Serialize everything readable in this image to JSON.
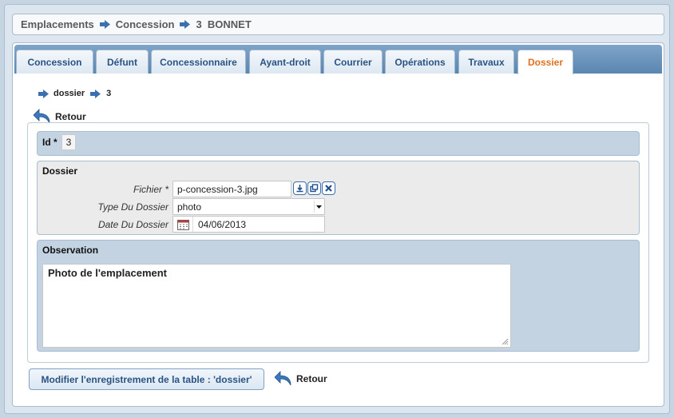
{
  "breadcrumb": {
    "items": [
      "Emplacements",
      "Concession",
      "3  BONNET"
    ]
  },
  "tabs": [
    {
      "label": "Concession"
    },
    {
      "label": "Défunt"
    },
    {
      "label": "Concessionnaire"
    },
    {
      "label": "Ayant-droit"
    },
    {
      "label": "Courrier"
    },
    {
      "label": "Opérations"
    },
    {
      "label": "Travaux"
    },
    {
      "label": "Dossier"
    }
  ],
  "active_tab": "Dossier",
  "sub_breadcrumb": {
    "items": [
      "dossier",
      "3"
    ]
  },
  "retour_label": "Retour",
  "id_section": {
    "label": "Id *",
    "value": "3"
  },
  "dossier_section": {
    "title": "Dossier",
    "fichier_label": "Fichier *",
    "fichier_value": "p-concession-3.jpg",
    "type_label": "Type Du Dossier",
    "type_value": "photo",
    "date_label": "Date Du Dossier",
    "date_value": "04/06/2013"
  },
  "observation_section": {
    "title": "Observation",
    "value": "Photo de l'emplacement"
  },
  "submit_label": "Modifier l'enregistrement de la table : 'dossier'",
  "colors": {
    "accent_blue": "#2a5384",
    "active_tab_orange": "#e07020",
    "section_bg": "#c3d3e2",
    "section_alt_bg": "#ebebeb"
  }
}
